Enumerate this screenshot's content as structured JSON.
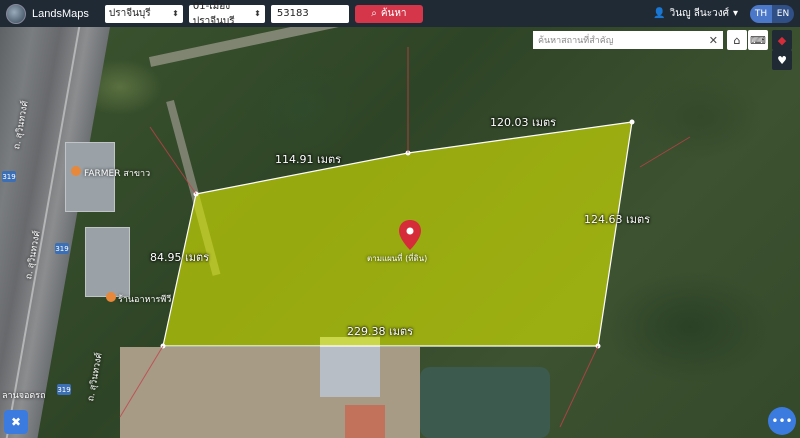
{
  "header": {
    "brand": "LandsMaps",
    "province": "ปราจีนบุรี",
    "district": "01-เมืองปราจีนบุรี",
    "parcel_number": "53183",
    "search_label": "ค้นหา",
    "user_name": "วินญู ลีนะวงศ์",
    "lang_th": "TH",
    "lang_en": "EN"
  },
  "poi_search": {
    "placeholder": "ค้นหาสถานที่สำคัญ"
  },
  "map": {
    "measurements": {
      "north_left": "114.91 เมตร",
      "north_right": "120.03 เมตร",
      "east": "124.63 เมตร",
      "west": "84.95 เมตร",
      "south": "229.38 เมตร"
    },
    "parcel_label": "ตามแผนที่ (ที่ดิน)",
    "places": {
      "farmer": "FARMER สาขาว",
      "shop": "ร้านอาหารพีวี",
      "bottom_left": "ลานจอดรถ"
    },
    "road_labels": {
      "upper": "ถ. สุวินทวงศ์",
      "middle": "ถ. สุวินทวงศ์",
      "lower": "ถ. สุวินทวงศ์"
    },
    "highway_numbers": [
      "319",
      "319",
      "319"
    ]
  },
  "colors": {
    "topbar": "#1f2a35",
    "accent_red": "#d6364a",
    "parcel_fill": "#d7e600",
    "lang_active": "#4b78c8",
    "fab_blue": "#3b7be0"
  }
}
